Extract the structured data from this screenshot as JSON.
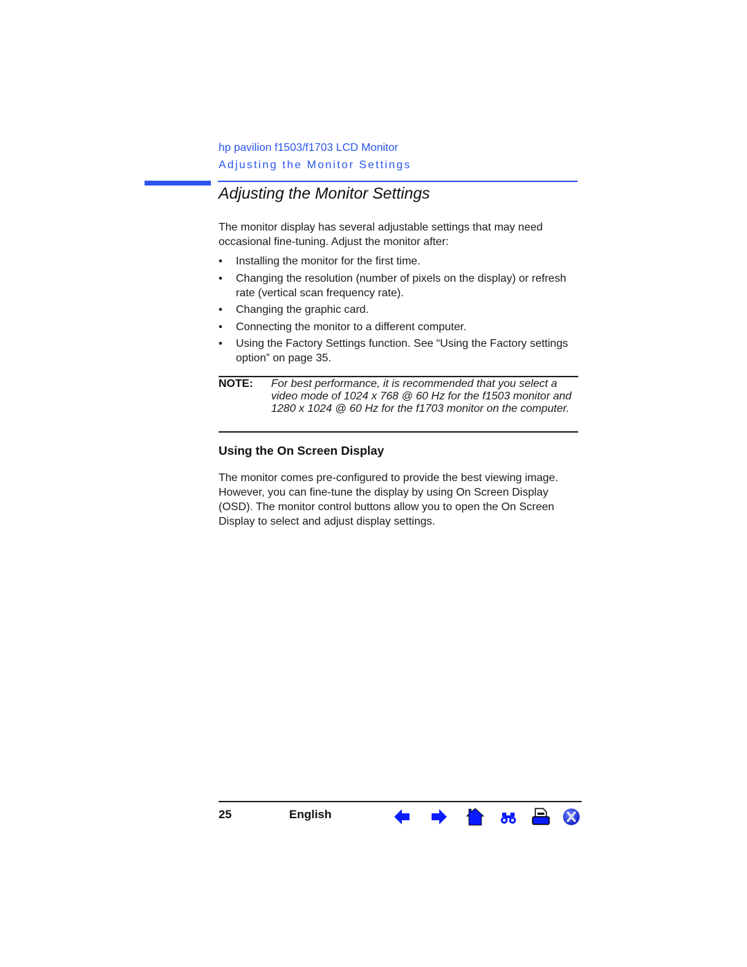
{
  "header": {
    "product": "hp pavilion f1503/f1703 LCD Monitor",
    "chapter": "Adjusting the Monitor Settings",
    "accent_color": "#2e56f0"
  },
  "page_title": "Adjusting the Monitor Settings",
  "intro": "The monitor display has several adjustable settings that may need occasional fine-tuning. Adjust the monitor after:",
  "bullets": [
    "Installing the monitor for the first time.",
    "Changing the resolution (number of pixels on the display) or refresh rate (vertical scan frequency rate).",
    "Changing the graphic card.",
    "Connecting the monitor to a different computer.",
    "Using the Factory Settings function. See “Using the Factory settings option” on page 35."
  ],
  "bullet_glyph": "•",
  "note": {
    "label": "NOTE:",
    "text": "For best performance, it is recommended that you select a video mode of 1024 x 768 @ 60 Hz for the f1503 monitor and 1280 x 1024 @ 60 Hz for the f1703 monitor on the computer."
  },
  "section": {
    "heading": "Using the On Screen Display",
    "text": "The monitor comes pre-configured to provide the best viewing image. However, you can fine-tune the display by using On Screen Display (OSD). The monitor control buttons allow you to open the On Screen Display to select and adjust display settings."
  },
  "footer": {
    "page_number": "25",
    "language": "English",
    "nav_icons": [
      "previous-page-icon",
      "next-page-icon",
      "home-icon",
      "search-binoculars-icon",
      "print-icon",
      "exit-icon"
    ],
    "icon_color": "#0a1cff"
  }
}
